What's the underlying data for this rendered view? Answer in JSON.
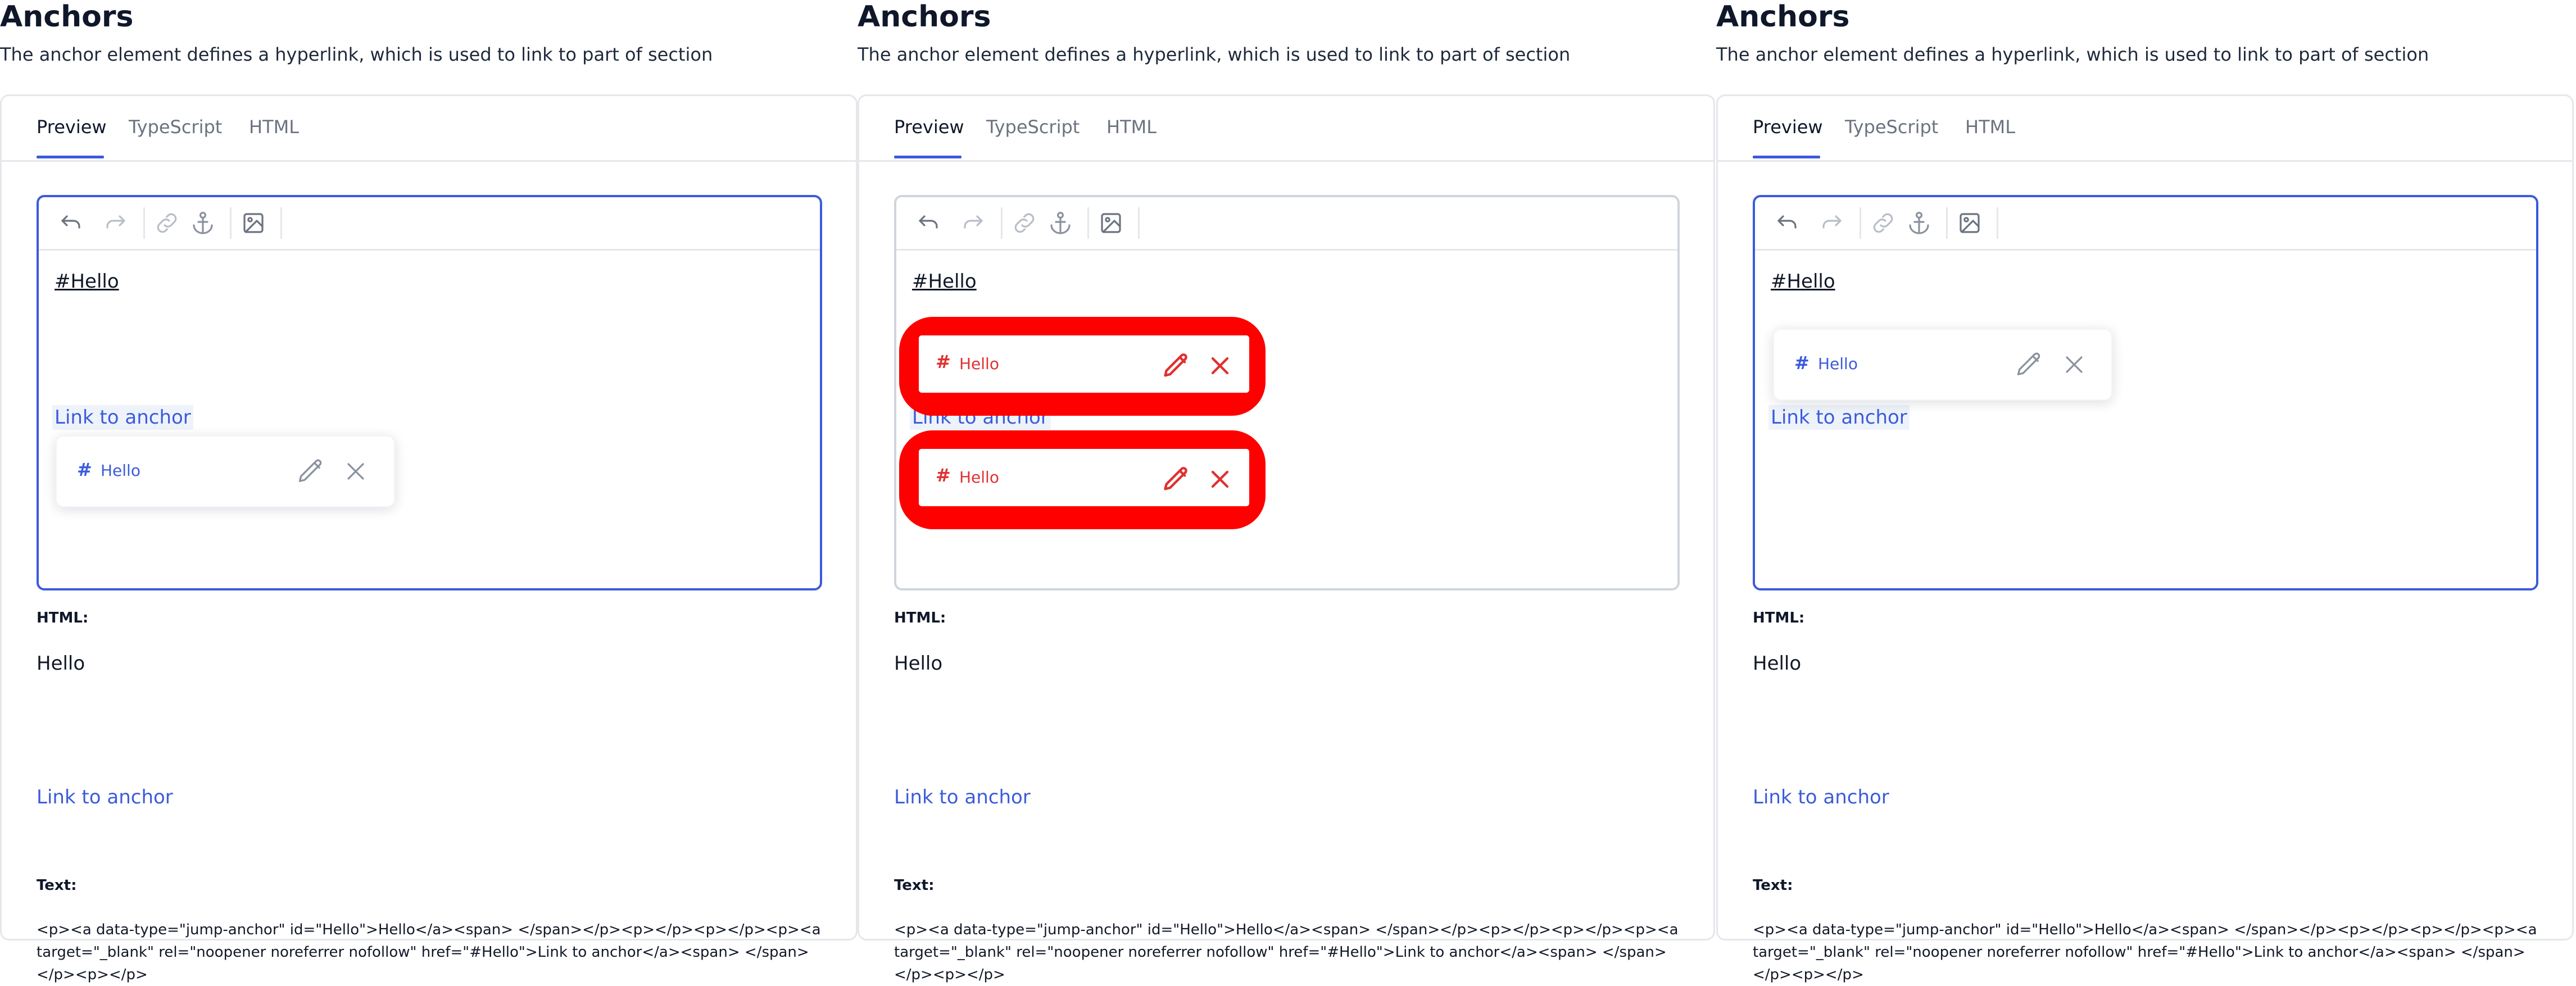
{
  "page": {
    "title": "Anchors",
    "description": "The anchor element defines a hyperlink, which is used to link to part of section"
  },
  "tabs": [
    "Preview",
    "TypeScript",
    "HTML"
  ],
  "toolbar": {
    "buttons": [
      "undo-icon",
      "redo-icon",
      "link-icon",
      "anchor-icon",
      "image-icon"
    ]
  },
  "editor": {
    "anchor_text": "#Hello",
    "link_text": "Link to anchor"
  },
  "popup": {
    "hash_symbol": "#",
    "label": "Hello",
    "edit_icon": "pencil-icon",
    "close_icon": "close-icon"
  },
  "output": {
    "html_label": "HTML:",
    "hello": "Hello",
    "link": "Link to anchor",
    "text_label": "Text:",
    "code": "<p><a data-type=\"jump-anchor\" id=\"Hello\">Hello</a><span> </span></p><p></p><p></p><p><a target=\"_blank\" rel=\"noopener noreferrer nofollow\" href=\"#Hello\">Link to anchor</a><span> </span></p><p></p>"
  },
  "colors": {
    "accent": "#3b5bdb",
    "highlight": "#ff0000",
    "highlight_text": "#e03131"
  }
}
